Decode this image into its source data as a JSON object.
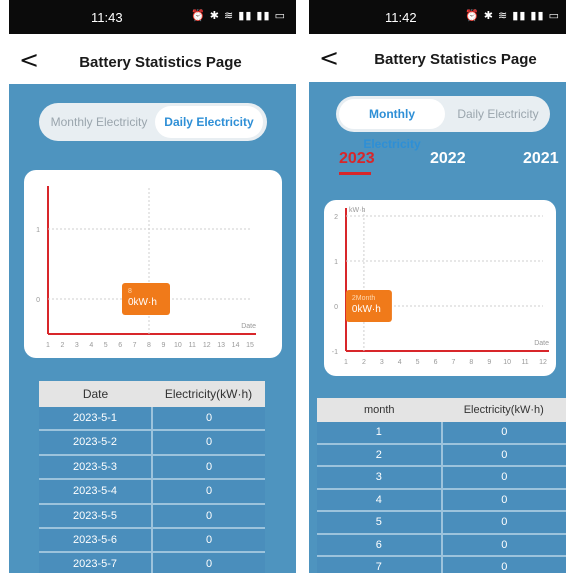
{
  "left": {
    "status_time": "11:43",
    "status_icons": "⏰ ✱ ≋ ▮▮ ▮▮ ▭",
    "back_glyph": "<",
    "title": "Battery Statistics Page",
    "toggle": {
      "monthly": "Monthly Electricity",
      "daily": "Daily Electricity",
      "active": "daily"
    },
    "chart": {
      "y_ticks": [
        "1",
        "0"
      ],
      "x_ticks": [
        "1",
        "2",
        "3",
        "4",
        "5",
        "6",
        "7",
        "8",
        "9",
        "10",
        "11",
        "12",
        "13",
        "14",
        "15"
      ],
      "x_label": "Date",
      "tooltip_title": "8",
      "tooltip_value": "0kW·h"
    },
    "table": {
      "headers": [
        "Date",
        "Electricity(kW·h)"
      ],
      "rows": [
        [
          "2023-5-1",
          "0"
        ],
        [
          "2023-5-2",
          "0"
        ],
        [
          "2023-5-3",
          "0"
        ],
        [
          "2023-5-4",
          "0"
        ],
        [
          "2023-5-5",
          "0"
        ],
        [
          "2023-5-6",
          "0"
        ],
        [
          "2023-5-7",
          "0"
        ]
      ]
    }
  },
  "right": {
    "status_time": "11:42",
    "status_icons": "⏰ ✱ ≋ ▮▮ ▮▮ ▭",
    "back_glyph": "<",
    "title": "Battery Statistics Page",
    "toggle": {
      "monthly": "Monthly Electricity",
      "daily": "Daily Electricity",
      "active": "monthly"
    },
    "years": [
      "2023",
      "2022",
      "2021"
    ],
    "active_year": "2023",
    "chart": {
      "y_unit": "kW·h",
      "y_ticks": [
        "2",
        "1",
        "0",
        "-1"
      ],
      "x_ticks": [
        "1",
        "2",
        "3",
        "4",
        "5",
        "6",
        "7",
        "8",
        "9",
        "10",
        "11",
        "12"
      ],
      "x_label": "Date",
      "tooltip_title": "2Month",
      "tooltip_value": "0kW·h"
    },
    "table": {
      "headers": [
        "month",
        "Electricity(kW·h)"
      ],
      "rows": [
        [
          "1",
          "0"
        ],
        [
          "2",
          "0"
        ],
        [
          "3",
          "0"
        ],
        [
          "4",
          "0"
        ],
        [
          "5",
          "0"
        ],
        [
          "6",
          "0"
        ],
        [
          "7",
          "0"
        ]
      ]
    }
  },
  "colors": {
    "accent": "#2e8fd6",
    "axis": "#d8262a",
    "tooltip": "#f07a1a",
    "background": "#4e94bf"
  },
  "chart_data": [
    {
      "type": "line",
      "x": [
        1,
        2,
        3,
        4,
        5,
        6,
        7,
        8,
        9,
        10,
        11,
        12,
        13,
        14,
        15
      ],
      "series": [
        {
          "values": [
            0,
            0,
            0,
            0,
            0,
            0,
            0,
            0,
            0,
            0,
            0,
            0,
            0,
            0,
            0
          ]
        }
      ],
      "xlabel": "Date",
      "ylim": [
        -0.5,
        1.5
      ],
      "tooltip": {
        "x": 8,
        "y": 0,
        "title": "8",
        "value": "0kW·h"
      },
      "grid": "dashed"
    },
    {
      "type": "line",
      "x": [
        1,
        2,
        3,
        4,
        5,
        6,
        7,
        8,
        9,
        10,
        11,
        12
      ],
      "series": [
        {
          "values": [
            0,
            0,
            0,
            0,
            0,
            0,
            0,
            0,
            0,
            0,
            0,
            0
          ]
        }
      ],
      "xlabel": "Date",
      "ylabel": "kW·h",
      "ylim": [
        -1,
        2
      ],
      "tooltip": {
        "x": 2,
        "y": 0,
        "title": "2Month",
        "value": "0kW·h"
      },
      "grid": "dashed"
    }
  ]
}
